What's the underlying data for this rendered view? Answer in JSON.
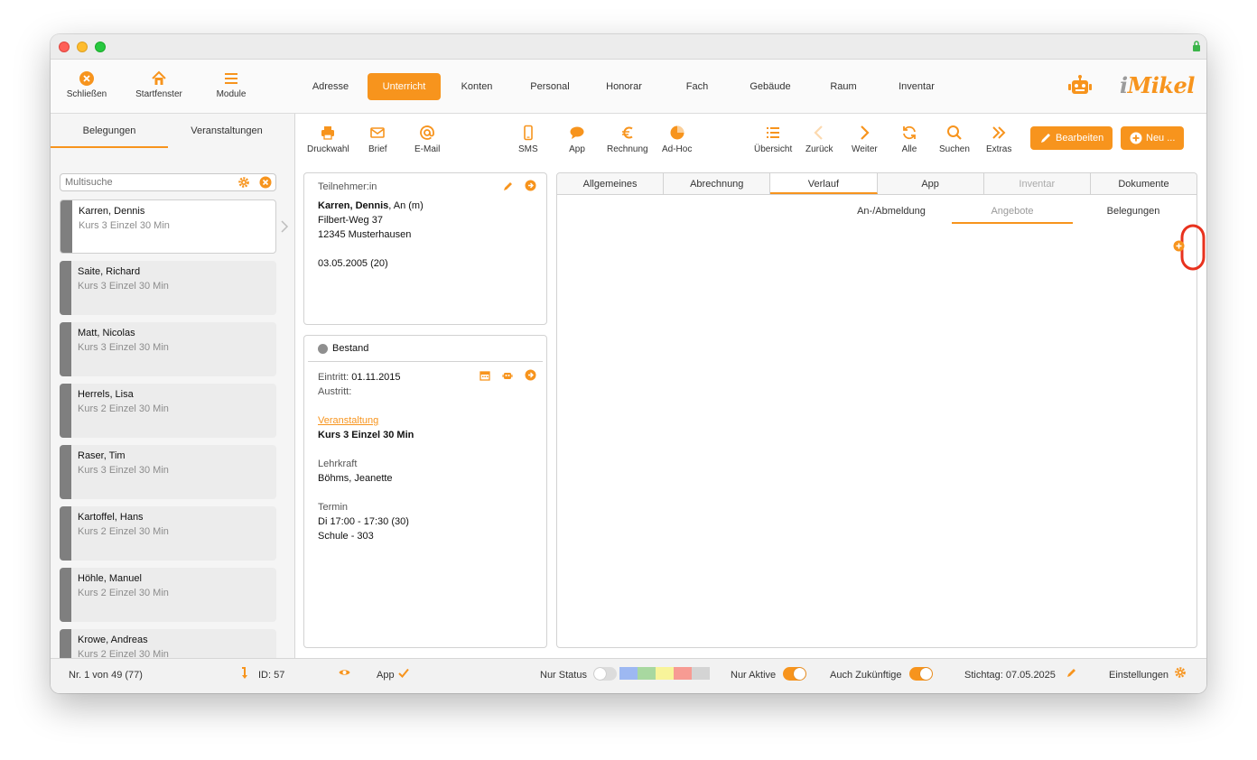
{
  "toolbar": {
    "buttons": [
      {
        "label": "Schließen",
        "icon": "close-circle-icon"
      },
      {
        "label": "Startfenster",
        "icon": "home-icon"
      },
      {
        "label": "Module",
        "icon": "menu-icon"
      }
    ],
    "modules": [
      "Adresse",
      "Unterricht",
      "Konten",
      "Personal",
      "Honorar",
      "Fach",
      "Gebäude",
      "Raum",
      "Inventar"
    ],
    "active_module": "Unterricht",
    "logo_i": "i",
    "logo_rest": "Mikel"
  },
  "sidebar": {
    "tabs": [
      "Belegungen",
      "Veranstaltungen"
    ],
    "search_placeholder": "Multisuche",
    "items": [
      {
        "name": "Karren, Dennis",
        "course": "Kurs 3 Einzel 30 Min"
      },
      {
        "name": "Saite, Richard",
        "course": "Kurs 3 Einzel 30 Min"
      },
      {
        "name": "Matt, Nicolas",
        "course": "Kurs 3 Einzel 30 Min"
      },
      {
        "name": "Herrels, Lisa",
        "course": "Kurs 2 Einzel 30 Min"
      },
      {
        "name": "Raser, Tim",
        "course": "Kurs 3 Einzel 30 Min"
      },
      {
        "name": "Kartoffel, Hans",
        "course": "Kurs 2 Einzel 30 Min"
      },
      {
        "name": "Höhle, Manuel",
        "course": "Kurs 2 Einzel 30 Min"
      },
      {
        "name": "Krowe, Andreas",
        "course": "Kurs 2 Einzel 30 Min"
      }
    ]
  },
  "actions": {
    "left": [
      {
        "label": "Druckwahl",
        "icon": "printer-icon"
      },
      {
        "label": "Brief",
        "icon": "envelope-icon"
      },
      {
        "label": "E-Mail",
        "icon": "at-icon"
      },
      {
        "label": "SMS",
        "icon": "phone-icon"
      },
      {
        "label": "App",
        "icon": "chat-icon"
      },
      {
        "label": "Rechnung",
        "icon": "euro-icon"
      },
      {
        "label": "Ad-Hoc",
        "icon": "pie-chart-icon"
      }
    ],
    "right": [
      {
        "label": "Übersicht",
        "icon": "list-icon"
      },
      {
        "label": "Zurück",
        "icon": "chevron-left-icon"
      },
      {
        "label": "Weiter",
        "icon": "chevron-right-icon"
      },
      {
        "label": "Alle",
        "icon": "refresh-icon"
      },
      {
        "label": "Suchen",
        "icon": "search-icon"
      },
      {
        "label": "Extras",
        "icon": "double-chevron-icon"
      }
    ],
    "edit_label": "Bearbeiten",
    "new_label": "Neu ..."
  },
  "participant": {
    "header": "Teilnehmer:in",
    "name": "Karren, Dennis",
    "salutation": ", An (m)",
    "street": "Filbert-Weg 37",
    "city": "12345 Musterhausen",
    "birth": "03.05.2005 (20)"
  },
  "enrollment": {
    "status": "Bestand",
    "entry_label": "Eintritt:",
    "entry_date": "01.11.2015",
    "exit_label": "Austritt:",
    "event_label": "Veranstaltung",
    "event_value": "Kurs 3 Einzel 30 Min",
    "teacher_label": "Lehrkraft",
    "teacher_value": "Böhms, Jeanette",
    "schedule_label": "Termin",
    "schedule_time": "Di 17:00 - 17:30 (30)",
    "schedule_place": "Schule - 303"
  },
  "detail": {
    "tabs": [
      "Allgemeines",
      "Abrechnung",
      "Verlauf",
      "App",
      "Inventar",
      "Dokumente"
    ],
    "active_tab": "Verlauf",
    "subtabs": [
      "An-/Abmeldung",
      "Angebote",
      "Belegungen"
    ],
    "active_subtab": "Angebote"
  },
  "status": {
    "record": "Nr. 1 von 49 (77)",
    "id": "ID: 57",
    "app": "App",
    "nur_status": "Nur Status",
    "nur_aktive": "Nur Aktive",
    "auch_zukuenftige": "Auch Zukünftige",
    "stichtag": "Stichtag: 07.05.2025",
    "einstellungen": "Einstellungen",
    "swatch_colors": [
      "#9db8f2",
      "#a8d8a0",
      "#f8f49a",
      "#f79b93",
      "#d4d4d4"
    ]
  },
  "colors": {
    "accent": "#f7941d",
    "highlight_ring": "#e8321e"
  }
}
